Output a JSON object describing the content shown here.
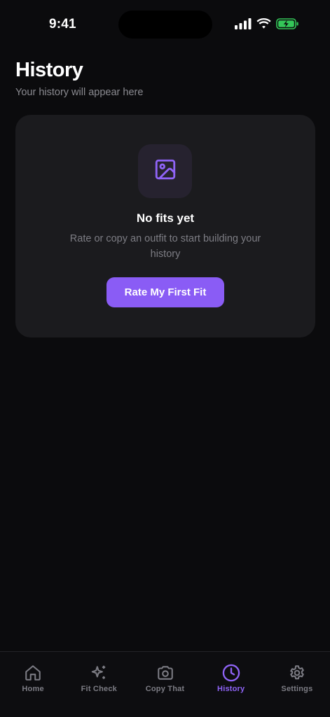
{
  "status_bar": {
    "time": "9:41"
  },
  "header": {
    "title": "History",
    "subtitle": "Your history will appear here"
  },
  "empty_state": {
    "icon": "image-icon",
    "title": "No fits yet",
    "description": "Rate or copy an outfit to start building your history",
    "button_label": "Rate My First Fit"
  },
  "tab_bar": {
    "active_index": 3,
    "tabs": [
      {
        "label": "Home",
        "icon": "home-icon"
      },
      {
        "label": "Fit Check",
        "icon": "sparkles-icon"
      },
      {
        "label": "Copy That",
        "icon": "camera-icon"
      },
      {
        "label": "History",
        "icon": "clock-icon"
      },
      {
        "label": "Settings",
        "icon": "gear-icon"
      }
    ]
  },
  "colors": {
    "background": "#0b0b0d",
    "card": "#1b1b1e",
    "accent": "#8a5cf5",
    "battery": "#34c759",
    "inactive_tab": "#7c7c84"
  }
}
